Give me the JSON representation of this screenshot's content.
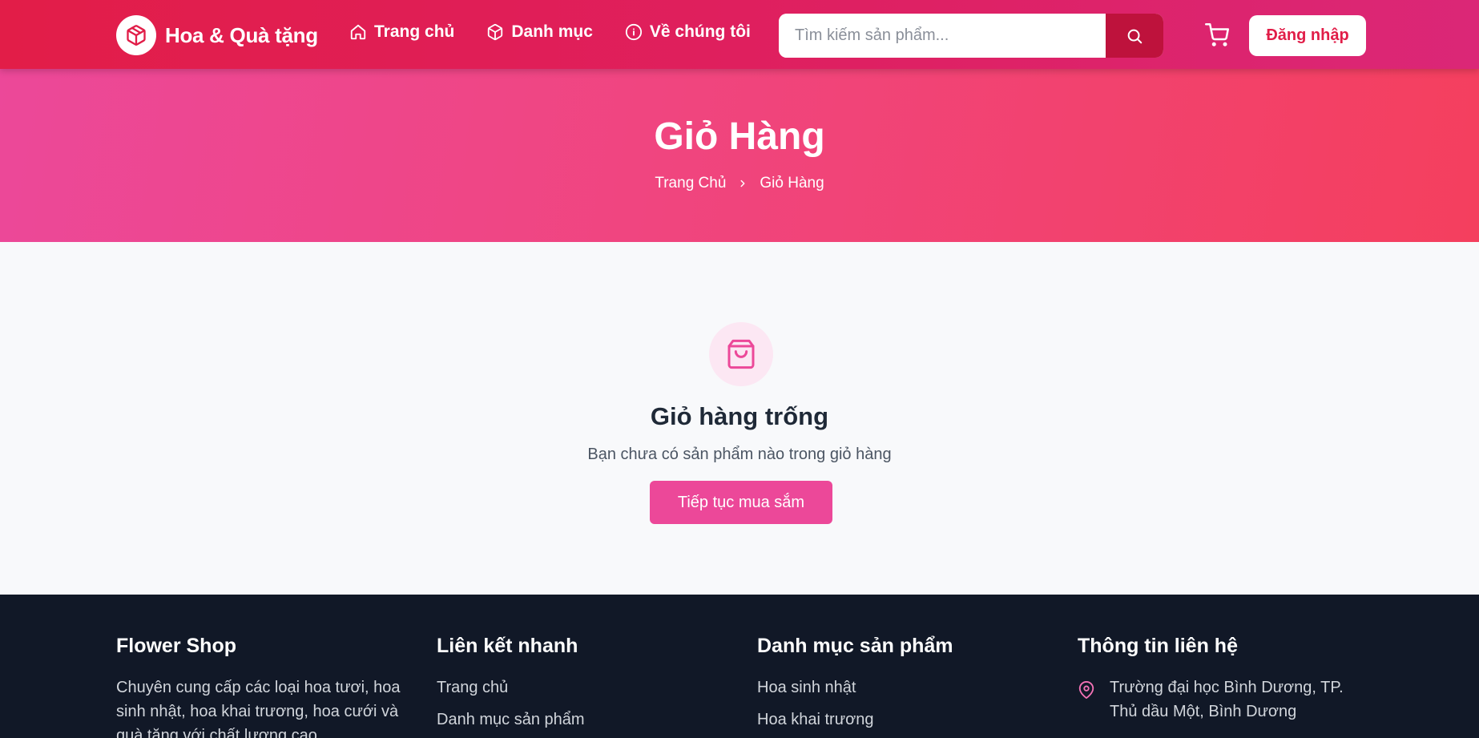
{
  "brand": {
    "name": "Hoa & Quà tặng"
  },
  "nav": {
    "links": [
      {
        "label": "Trang chủ",
        "icon": "home-icon"
      },
      {
        "label": "Danh mục",
        "icon": "box-icon"
      },
      {
        "label": "Về chúng tôi",
        "icon": "info-icon"
      }
    ]
  },
  "search": {
    "placeholder": "Tìm kiếm sản phẩm...",
    "value": ""
  },
  "header": {
    "login_label": "Đăng nhập"
  },
  "hero": {
    "title": "Giỏ Hàng",
    "breadcrumb": [
      "Trang Chủ",
      "Giỏ Hàng"
    ]
  },
  "cart": {
    "empty_title": "Giỏ hàng trống",
    "empty_message": "Bạn chưa có sản phẩm nào trong giỏ hàng",
    "continue_label": "Tiếp tục mua sắm"
  },
  "footer": {
    "about": {
      "title": "Flower Shop",
      "text": "Chuyên cung cấp các loại hoa tươi, hoa sinh nhật, hoa khai trương, hoa cưới và quà tặng với chất lượng cao"
    },
    "quick_links": {
      "title": "Liên kết nhanh",
      "items": [
        "Trang chủ",
        "Danh mục sản phẩm"
      ]
    },
    "categories": {
      "title": "Danh mục sản phẩm",
      "items": [
        "Hoa sinh nhật",
        "Hoa khai trương"
      ]
    },
    "contact": {
      "title": "Thông tin liên hệ",
      "address": "Trường đại học Bình Dương, TP. Thủ dầu Một, Bình Dương"
    }
  },
  "colors": {
    "primary": "#e11d48",
    "pink": "#ec4899",
    "footer_bg": "#111827"
  }
}
